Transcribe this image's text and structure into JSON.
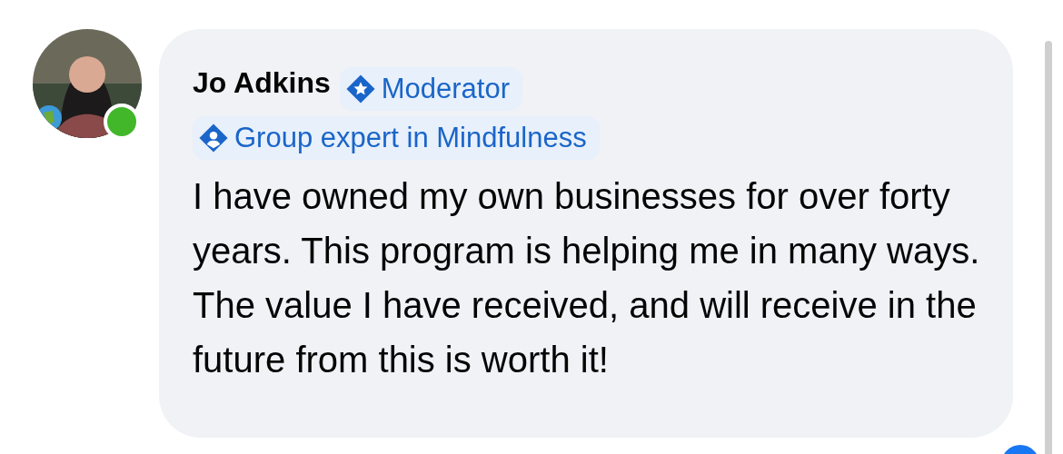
{
  "comment": {
    "author": "Jo Adkins",
    "online": true,
    "badges": [
      {
        "kind": "moderator",
        "label": "Moderator"
      },
      {
        "kind": "expert",
        "label": "Group expert in Mindfulness"
      }
    ],
    "text": "I have owned my own businesses for over forty years. This program is helping me in many ways. The value I have received, and will receive in the future from this is worth it!"
  }
}
